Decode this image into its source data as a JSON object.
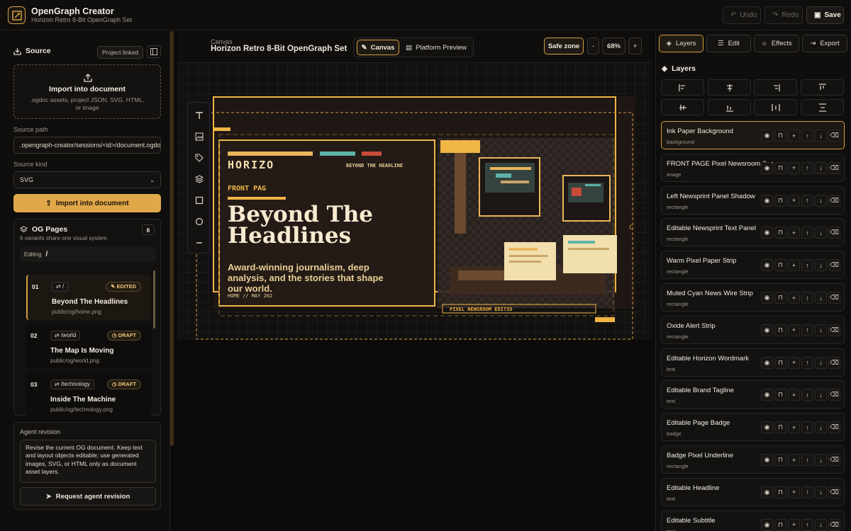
{
  "header": {
    "app_title": "OpenGraph Creator",
    "app_subtitle": "Horizon Retro 8-Bit OpenGraph Set",
    "undo": "Undo",
    "redo": "Redo",
    "save": "Save"
  },
  "source": {
    "title": "Source",
    "project_chip": "Project linked",
    "import_title": "Import into document",
    "import_hint": ".ogdoc assets, project JSON, SVG, HTML, or image",
    "path_label": "Source path",
    "path_value": ".opengraph-creator/sessions/<id>/document.ogdoc",
    "kind_label": "Source kind",
    "kind_value": "SVG",
    "import_button": "Import into document"
  },
  "og_pages": {
    "title": "OG Pages",
    "count": "6",
    "subtitle": "6 variants share one visual system",
    "editing_label": "Editing",
    "editing_value": "/",
    "items": [
      {
        "num": "01",
        "route": "/",
        "badge": "EDITED",
        "title": "Beyond The Headlines",
        "path": "public/og/home.png"
      },
      {
        "num": "02",
        "route": "/world",
        "badge": "DRAFT",
        "title": "The Map Is Moving",
        "path": "public/og/world.png"
      },
      {
        "num": "03",
        "route": "/technology",
        "badge": "DRAFT",
        "title": "Inside The Machine",
        "path": "public/og/technology.png"
      }
    ]
  },
  "agent": {
    "label": "Agent revision",
    "prompt": "Revise the current OG document. Keep text and layout objects editable; use generated images, SVG, or HTML only as document asset layers.",
    "button": "Request agent revision"
  },
  "canvas_bar": {
    "label": "Canvas",
    "title": "Horizon Retro 8-Bit OpenGraph Set",
    "tab_canvas": "Canvas",
    "tab_preview": "Platform Preview",
    "safe_zone": "Safe zone",
    "zoom_minus": "-",
    "zoom": "68%",
    "zoom_plus": "+"
  },
  "og": {
    "wordmark": "HORIZO",
    "tagline": "BEYOND THE HEADLINE",
    "badge": "FRONT PAG",
    "headline1": "Beyond The",
    "headline2": "Headlines",
    "subtitle1": "Award-winning journalism, deep",
    "subtitle2": "analysis, and the stories that shape",
    "subtitle3": "our world.",
    "footer": "HOME // MAY 202",
    "edition": "PIXEL NEWSROOM EDITIO",
    "edge": "C",
    "colors": {
      "ink": "#1f1714",
      "paper": "#e9cf95",
      "accent": "#f0b545",
      "cyan": "#5db3a9",
      "oxide": "#c84b3a"
    }
  },
  "right": {
    "tabs": [
      "Layers",
      "Edit",
      "Effects",
      "Export"
    ],
    "section": "Layers",
    "layers": [
      {
        "name": "Ink Paper Background",
        "type": "background"
      },
      {
        "name": "FRONT PAGE Pixel Newsroom Scene",
        "type": "image"
      },
      {
        "name": "Left Newsprint Panel Shadow",
        "type": "rectangle"
      },
      {
        "name": "Editable Newsprint Text Panel",
        "type": "rectangle"
      },
      {
        "name": "Warm Pixel Paper Strip",
        "type": "rectangle"
      },
      {
        "name": "Muted Cyan News Wire Strip",
        "type": "rectangle"
      },
      {
        "name": "Oxide Alert Strip",
        "type": "rectangle"
      },
      {
        "name": "Editable Horizon Wordmark",
        "type": "text"
      },
      {
        "name": "Editable Brand Tagline",
        "type": "text"
      },
      {
        "name": "Editable Page Badge",
        "type": "badge"
      },
      {
        "name": "Badge Pixel Underline",
        "type": "rectangle"
      },
      {
        "name": "Editable Headline",
        "type": "text"
      },
      {
        "name": "Editable Subtitle",
        "type": "text"
      }
    ]
  }
}
